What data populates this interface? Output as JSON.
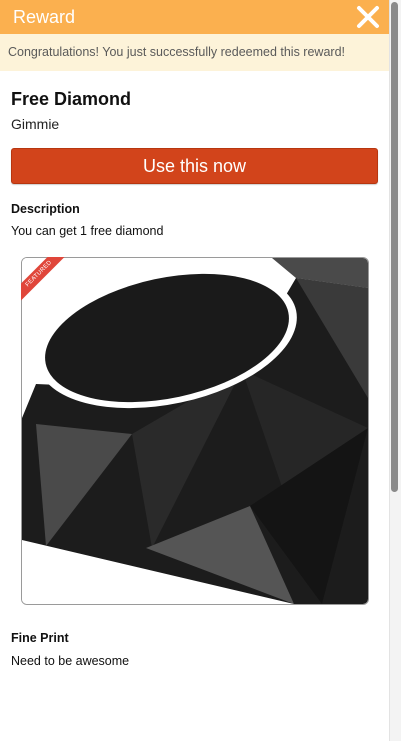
{
  "header": {
    "title": "Reward",
    "close_icon": "close-x-icon",
    "color": "#fbb04f"
  },
  "banner": {
    "text": "Congratulations! You just successfully redeemed this reward!",
    "color": "#fdf3d9"
  },
  "reward": {
    "title": "Free Diamond",
    "subtitle": "Gimmie"
  },
  "cta": {
    "label": "Use this now",
    "color": "#d2441b"
  },
  "description": {
    "heading": "Description",
    "text": "You can get 1 free diamond"
  },
  "image": {
    "ribbon": "FEATURED",
    "ribbon_color": "#e0463a",
    "subject": "black-gem-image"
  },
  "fine_print": {
    "heading": "Fine Print",
    "text": "Need to be awesome"
  }
}
